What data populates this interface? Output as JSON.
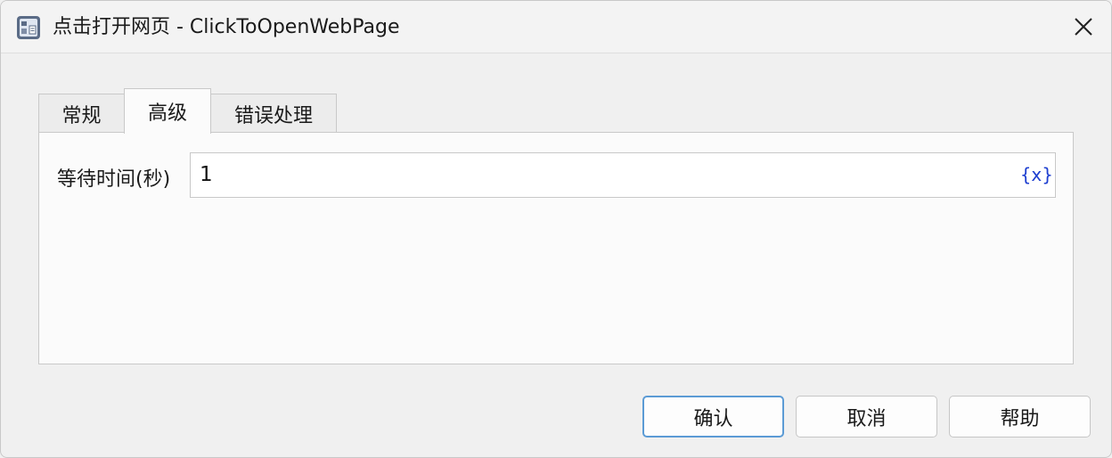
{
  "window": {
    "title": "点击打开网页 - ClickToOpenWebPage",
    "app_icon": "robot-workflow-icon",
    "close_icon": "close-icon"
  },
  "tabs": [
    {
      "label": "常规",
      "active": false
    },
    {
      "label": "高级",
      "active": true
    },
    {
      "label": "错误处理",
      "active": false
    }
  ],
  "advanced": {
    "wait_label": "等待时间(秒)",
    "wait_value": "1",
    "variable_button": "{x}"
  },
  "buttons": {
    "ok": "确认",
    "cancel": "取消",
    "help": "帮助"
  },
  "colors": {
    "accent": "#5b9bd5",
    "variable_link": "#1e3fd0"
  }
}
